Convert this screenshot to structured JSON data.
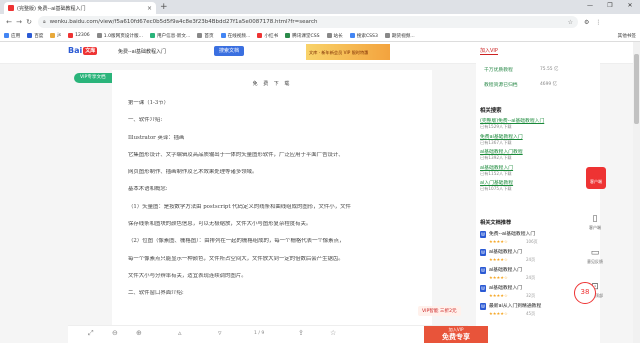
{
  "browser": {
    "tab_title": "(完整版) 免费--ai基础教程入门",
    "tab_close": "×",
    "new_tab": "+",
    "address": "wenku.baidu.com/view/f5a610fd67ec0b5d5f9a4c8e3f23b4Bbdd27f1a5e0087178.html?fr=search",
    "window_controls": [
      "—",
      "❐",
      "✕"
    ]
  },
  "bookmarks": [
    {
      "label": "应用",
      "color": "#4285f4"
    },
    {
      "label": "百度",
      "color": "#2b5ad4"
    },
    {
      "label": "js",
      "color": "#e8a93b"
    },
    {
      "label": "12306",
      "color": "#e33"
    },
    {
      "label": "1.0版网页设计版...",
      "color": "#888"
    },
    {
      "label": "用户信息·新文...",
      "color": "#2ab47a"
    },
    {
      "label": "首页",
      "color": "#888"
    },
    {
      "label": "在线视频...",
      "color": "#4285f4"
    },
    {
      "label": "小红书",
      "color": "#e33"
    },
    {
      "label": "腾讯课堂CSS",
      "color": "#2b8a4a"
    },
    {
      "label": "站长",
      "color": "#888"
    },
    {
      "label": "搜索CSS3",
      "color": "#4285f4"
    },
    {
      "label": "期货视频...",
      "color": "#888"
    }
  ],
  "bookmarks_right": "其他书签",
  "header": {
    "logo_text": "Bai",
    "logo_badge": "文库",
    "doc_name": "免费--ai基础教程入门",
    "search_button": "搜索文档",
    "ad_line1": "文库 · 新年新会员",
    "ad_line2": "VIP 限时特惠"
  },
  "vip_tag": "VIP专享文档",
  "download_tabs": "免 费 下 载",
  "document": {
    "lines": [
      "第一课（1-3节）",
      "一、软件介绍:",
      "Illustrator 英译：插画",
      "它集图形设计、文字编辑及高品质输出于一体的矢量图形软件，广泛应用于平面广告设计、",
      "网页图形制作、插画制作及艺术效果处理等诸多领域。",
      "基本术语和概念:",
      "（1）矢量图：是按数学方法由 postscript 代码定义的线条和曲线组成的图形，文件小，文件",
      "保存线条和图块的颜色信息，可以无极缩放，文件大小与图形复杂程度有关。",
      "（2）位图（像素图、栅格图）：由排列在一起的栅格组成的，每一个栅格代表一个像素点，",
      "每一个像素点只能显示一种颜色，文件所占空间大，文件放大到一定的倍数后会产生锯齿。",
      "文件大小与分辨率有关，适宜表现连续调的图片。",
      "二、软件窗口界面介绍:"
    ]
  },
  "right_panel": {
    "join_vip": "加入VIP",
    "stats": [
      {
        "label": "千万优质教程",
        "value": "75.55 亿"
      },
      {
        "label": "教程资源已归档",
        "value": "4699 亿"
      }
    ],
    "related_title": "相关搜索",
    "related": [
      {
        "link": "(完整版)免费--ai基础教程入门",
        "sub": "已有1529人下载"
      },
      {
        "link": "免费ai基础教程入门",
        "sub": "已有1367人下载"
      },
      {
        "link": "ai基础教程入门教程",
        "sub": "已有1392人下载"
      },
      {
        "link": "ai基础教程入门",
        "sub": "已有1152人下载"
      },
      {
        "link": "ai入门基础教程",
        "sub": "已有1075人下载"
      }
    ],
    "recommend_title": "相关文档推荐",
    "recommend": [
      {
        "title": "免费--ai基础教程入门",
        "stars": "★★★★☆",
        "count": "106页"
      },
      {
        "title": "ai基础教程入门",
        "stars": "★★★★☆",
        "count": "24页"
      },
      {
        "title": "ai基础教程入门",
        "stars": "★★★★☆",
        "count": "24页"
      },
      {
        "title": "ai基础教程入门",
        "stars": "★★★★☆",
        "count": "32页"
      },
      {
        "title": "最新ai从入门到精通教程",
        "stars": "★★★★☆",
        "count": "45页"
      }
    ]
  },
  "sidebar": {
    "promo": "客户端",
    "items": [
      {
        "icon": "▯",
        "label": "客户端"
      },
      {
        "icon": "▭",
        "label": "意见反馈"
      },
      {
        "icon": "⊡",
        "label": "返回顶部"
      }
    ],
    "progress": "38"
  },
  "bottom": {
    "page": "1 / 9",
    "vip_offer": "VIP智能 三折2元",
    "free_line1": "加入VIP",
    "free_line2": "免费专享"
  }
}
